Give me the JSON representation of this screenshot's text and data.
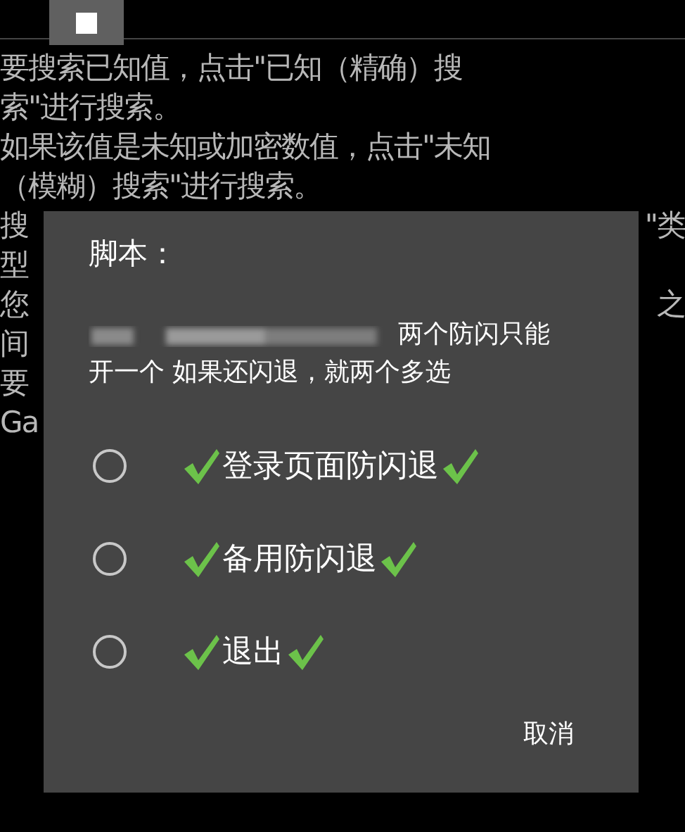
{
  "background": {
    "lines": [
      {
        "left": "要搜索已知值，点击\"已知（精确）搜"
      },
      {
        "left": "索\"进行搜索。"
      },
      {
        "left": "如果该值是未知或加密数值，点击\"未知"
      },
      {
        "left": "（模糊）搜索\"进行搜索。"
      },
      {
        "left": "搜",
        "right": "\"类"
      },
      {
        "left": "型"
      },
      {
        "left": "您",
        "right": "之"
      },
      {
        "left": "间"
      },
      {
        "left": "要"
      },
      {
        "left": "Ga"
      }
    ]
  },
  "dialog": {
    "title": "脚本：",
    "message_lines": [
      "两个防闪只能",
      "开一个 如果还闪退，就两个多选"
    ],
    "options": [
      {
        "label": "登录页面防闪退",
        "selected": false
      },
      {
        "label": "备用防闪退",
        "selected": false
      },
      {
        "label": "退出",
        "selected": false
      }
    ],
    "buttons": [
      "取消"
    ]
  }
}
